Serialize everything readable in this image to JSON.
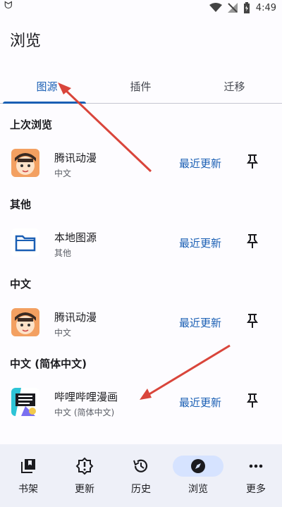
{
  "status": {
    "app_glyph": "ᗢ",
    "time": "4:49"
  },
  "title": "浏览",
  "tabs": [
    {
      "label": "图源",
      "active": true
    },
    {
      "label": "插件",
      "active": false
    },
    {
      "label": "迁移",
      "active": false
    }
  ],
  "sections": [
    "上次浏览",
    "其他",
    "中文",
    "中文 (简体中文)"
  ],
  "rows": [
    {
      "name": "腾讯动漫",
      "lang": "中文",
      "action": "最近更新",
      "icon": "tencent-comic-icon"
    },
    {
      "name": "本地图源",
      "lang": "其他",
      "action": "最近更新",
      "icon": "folder-icon"
    },
    {
      "name": "腾讯动漫",
      "lang": "中文",
      "action": "最近更新",
      "icon": "tencent-comic-icon"
    },
    {
      "name": "哔哩哔哩漫画",
      "lang": "中文 (简体中文)",
      "action": "最近更新",
      "icon": "bilibili-comic-icon"
    }
  ],
  "nav": [
    {
      "label": "书架",
      "icon": "library-icon"
    },
    {
      "label": "更新",
      "icon": "updates-icon"
    },
    {
      "label": "历史",
      "icon": "history-icon"
    },
    {
      "label": "浏览",
      "icon": "explore-icon",
      "active": true
    },
    {
      "label": "更多",
      "icon": "more-icon"
    }
  ],
  "colors": {
    "accent": "#1a5fb4",
    "annotation": "#d9453b",
    "nav_bg": "#eef0f8",
    "active_pill": "#d6e3ff"
  }
}
